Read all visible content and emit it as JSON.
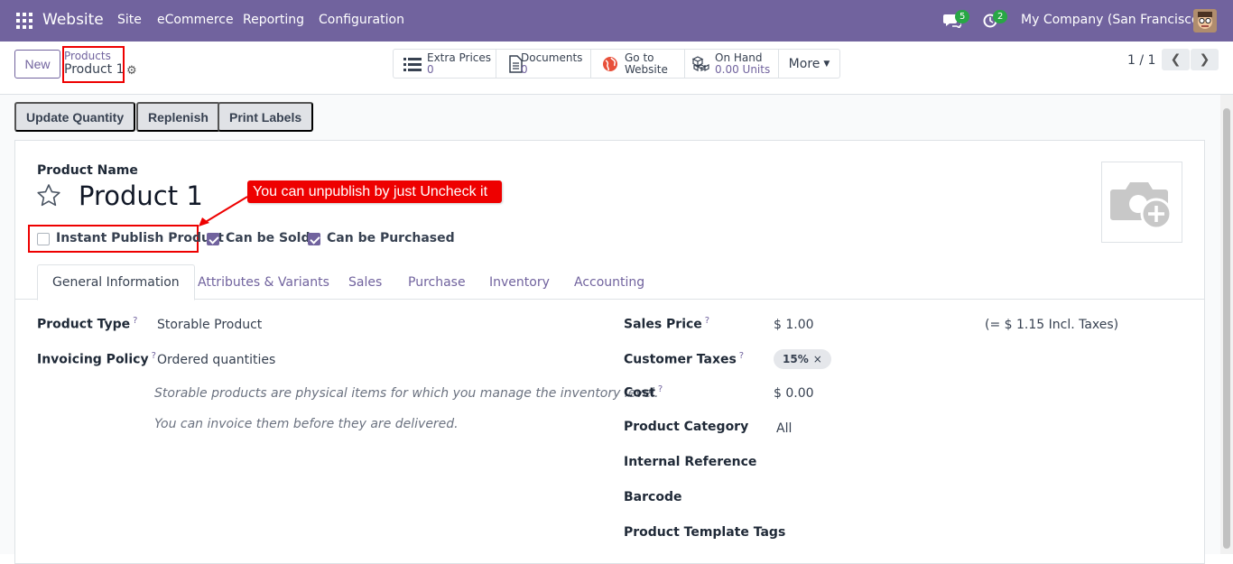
{
  "topbar": {
    "app_name": "Website",
    "menu": [
      "Site",
      "eCommerce",
      "Reporting",
      "Configuration"
    ],
    "messages_count": "5",
    "activities_count": "2",
    "company": "My Company (San Francisco)"
  },
  "control_panel": {
    "new_label": "New",
    "breadcrumb_parent": "Products",
    "breadcrumb_current": "Product 1",
    "stats": [
      {
        "label": "Extra Prices",
        "value": "0",
        "icon": "list-icon"
      },
      {
        "label": "Documents",
        "value": "0",
        "icon": "document-icon"
      },
      {
        "label": "Go to",
        "value": "Website",
        "icon": "globe-icon"
      },
      {
        "label": "On Hand",
        "value": "0.00 Units",
        "icon": "cubes-icon"
      }
    ],
    "more_label": "More",
    "pager": "1 / 1"
  },
  "statusbar": {
    "buttons": [
      "Update Quantity",
      "Replenish",
      "Print Labels"
    ]
  },
  "form": {
    "name_label": "Product Name",
    "name": "Product 1",
    "annotation": "You can unpublish by just Uncheck it",
    "checkboxes": [
      {
        "label": "Instant Publish Product",
        "checked": false
      },
      {
        "label": "Can be Sold",
        "checked": true
      },
      {
        "label": "Can be Purchased",
        "checked": true
      }
    ],
    "tabs": [
      "General Information",
      "Attributes & Variants",
      "Sales",
      "Purchase",
      "Inventory",
      "Accounting"
    ],
    "left": {
      "product_type_label": "Product Type",
      "product_type": "Storable Product",
      "invoicing_label": "Invoicing Policy",
      "invoicing": "Ordered quantities",
      "help1": "Storable products are physical items for which you manage the inventory level.",
      "help2": "You can invoice them before they are delivered."
    },
    "right": {
      "sales_price_label": "Sales Price",
      "sales_price": "$ 1.00",
      "incl_taxes": "(= $ 1.15 Incl. Taxes)",
      "customer_taxes_label": "Customer Taxes",
      "tax_tag": "15%",
      "cost_label": "Cost",
      "cost": "$ 0.00",
      "category_label": "Product Category",
      "category": "All",
      "internal_ref_label": "Internal Reference",
      "barcode_label": "Barcode",
      "template_tags_label": "Product Template Tags"
    },
    "help_mark": "?"
  },
  "colors": {
    "brand": "#71639e",
    "annotation": "#ee0000",
    "badge": "#28a745"
  }
}
